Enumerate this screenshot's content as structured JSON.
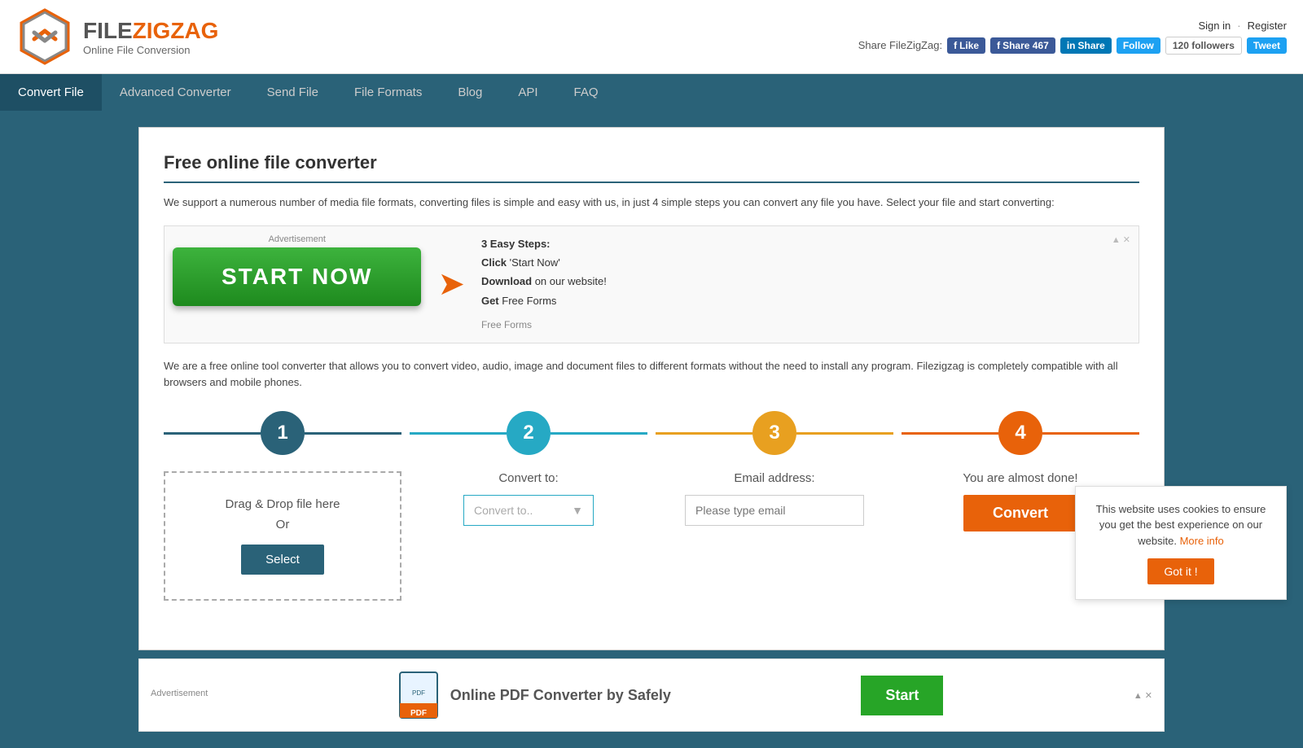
{
  "header": {
    "logo_text_file": "FILE",
    "logo_text_zigzag": "ZIGZAG",
    "logo_subtitle": "Online File Conversion",
    "sign_in": "Sign in",
    "register": "Register",
    "share_label": "Share FileZigZag:",
    "social": {
      "fb_like": "Like",
      "fb_share": "Share 467",
      "li_share": "Share",
      "tw_follow": "Follow",
      "tw_followers": "120 followers",
      "tw_tweet": "Tweet"
    }
  },
  "nav": {
    "items": [
      {
        "label": "Convert File",
        "active": true
      },
      {
        "label": "Advanced Converter",
        "active": false
      },
      {
        "label": "Send File",
        "active": false
      },
      {
        "label": "File Formats",
        "active": false
      },
      {
        "label": "Blog",
        "active": false
      },
      {
        "label": "API",
        "active": false
      },
      {
        "label": "FAQ",
        "active": false
      }
    ]
  },
  "main": {
    "title": "Free online file converter",
    "description": "We support a numerous number of media file formats, converting files is simple and easy with us, in just 4 simple steps you can convert any file you have. Select your file and start converting:",
    "ad": {
      "label": "Advertisement",
      "start_btn": "START NOW",
      "steps_title": "3 Easy Steps:",
      "step1": "1) Click 'Start Now'",
      "step2": "2) Download on our website!",
      "step3": "3) Get Free Forms",
      "free_forms": "Free Forms"
    },
    "body_text": "We are a free online tool converter that allows you to convert video, audio, image and document files to different formats without the need to install any program. Filezigzag is completely compatible with all browsers and mobile phones.",
    "steps": [
      {
        "number": "1",
        "color_class": "step-circle-1",
        "line_class": "line-1"
      },
      {
        "number": "2",
        "color_class": "step-circle-2",
        "line_class": "line-2"
      },
      {
        "number": "3",
        "color_class": "step-circle-3",
        "line_class": "line-3"
      },
      {
        "number": "4",
        "color_class": "step-circle-4",
        "line_class": "line-4"
      }
    ],
    "step1_drag": "Drag & Drop file here",
    "step1_or": "Or",
    "step1_select": "Select",
    "step2_label": "Convert to:",
    "step2_placeholder": "Convert to..",
    "step3_label": "Email address:",
    "step3_placeholder": "Please type email",
    "step4_label": "You are almost done!",
    "convert_btn": "Convert"
  },
  "cookie": {
    "text": "This website uses cookies to ensure you get the best experience on our website.",
    "more_info": "More info",
    "got_it": "Got it !"
  },
  "bottom_ad": {
    "label": "Advertisement",
    "title": "Online PDF Converter by Safely",
    "start_btn": "Start"
  }
}
